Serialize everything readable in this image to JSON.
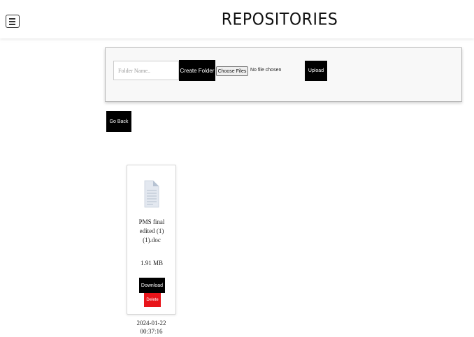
{
  "header": {
    "title": "REPOSITORIES",
    "menu_icon": "hamburger-menu-icon"
  },
  "toolbar": {
    "folder_name_placeholder": "Folder Name..",
    "folder_name_value": "",
    "create_folder_label": "Create Folder",
    "choose_files_label": "Choose Files",
    "file_status": "No file chosen",
    "upload_label": "Upload"
  },
  "navigation": {
    "go_back_label": "Go Back"
  },
  "files": [
    {
      "icon": "document-icon",
      "name_lines": [
        "PMS final",
        "edited (1)",
        "(1).doc"
      ],
      "size": "1.91 MB",
      "download_label": "Download",
      "delete_label": "Delete",
      "date": "2024-01-22",
      "time": "00:37:16"
    }
  ],
  "colors": {
    "primary_button": "#000000",
    "delete_button": "#e8141a"
  }
}
